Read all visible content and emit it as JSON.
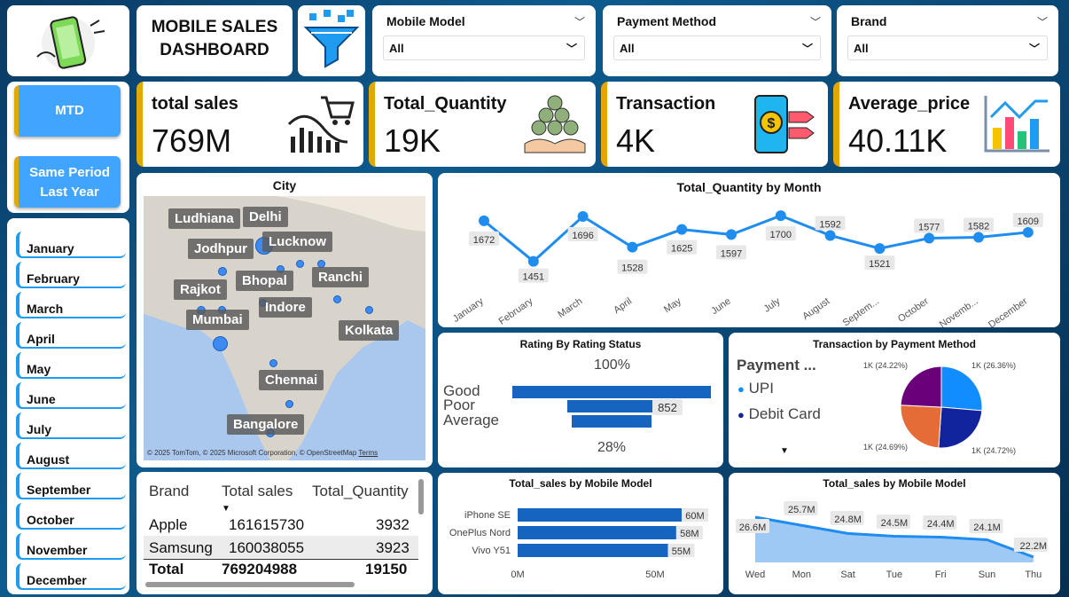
{
  "dashboard_title": "MOBILE SALES DASHBOARD",
  "icons": {
    "logo": "phone-icon",
    "filter": "funnel-icon"
  },
  "slicers": [
    {
      "label": "Mobile Model",
      "value": "All"
    },
    {
      "label": "Payment Method",
      "value": "All"
    },
    {
      "label": "Brand",
      "value": "All"
    }
  ],
  "buttons": {
    "mtd": "MTD",
    "spl": "Same Period Last Year"
  },
  "months": [
    "January",
    "February",
    "March",
    "April",
    "May",
    "June",
    "July",
    "August",
    "September",
    "October",
    "November",
    "December"
  ],
  "kpis": [
    {
      "label": "total sales",
      "value": "769M"
    },
    {
      "label": "Total_Quantity",
      "value": "19K"
    },
    {
      "label": "Transaction",
      "value": "4K"
    },
    {
      "label": "Average_price",
      "value": "40.11K"
    }
  ],
  "map": {
    "title": "City",
    "cities": [
      "Ludhiana",
      "Delhi",
      "Jodhpur",
      "Lucknow",
      "Bhopal",
      "Ranchi",
      "Rajkot",
      "Indore",
      "Mumbai",
      "Kolkata",
      "Chennai",
      "Bangalore"
    ],
    "attribution": "© 2025 TomTom, © 2025 Microsoft Corporation, © OpenStreetMap",
    "terms": "Terms"
  },
  "chart_data": [
    {
      "type": "line",
      "title": "Total_Quantity by Month",
      "categories": [
        "January",
        "February",
        "March",
        "April",
        "May",
        "June",
        "July",
        "August",
        "Septem...",
        "October",
        "Novemb...",
        "December"
      ],
      "values": [
        1672,
        1451,
        1696,
        1528,
        1625,
        1597,
        1700,
        1592,
        1521,
        1577,
        1582,
        1609
      ]
    },
    {
      "type": "bar",
      "title": "Rating By Rating Status",
      "categories": [
        "Good",
        "Poor",
        "Average"
      ],
      "pct_top": "100%",
      "pct_bottom": "28%",
      "data_label": "852",
      "values": [
        3000,
        852,
        852
      ]
    },
    {
      "type": "pie",
      "title": "Transaction by Payment Method",
      "legend_title": "Payment ...",
      "legend": [
        "UPI",
        "Debit Card"
      ],
      "slices": [
        {
          "label": "1K (26.36%)",
          "value": 26.36,
          "color": "#118dff"
        },
        {
          "label": "1K (24.72%)",
          "value": 24.72,
          "color": "#12239e"
        },
        {
          "label": "1K (24.69%)",
          "value": 24.69,
          "color": "#e66c37"
        },
        {
          "label": "1K (24.22%)",
          "value": 24.22,
          "color": "#6b007b"
        }
      ]
    },
    {
      "type": "bar",
      "title": "Total_sales by Mobile Model",
      "categories": [
        "iPhone SE",
        "OnePlus Nord",
        "Vivo Y51"
      ],
      "values": [
        60,
        58,
        55
      ],
      "labels": [
        "60M",
        "58M",
        "55M"
      ],
      "xticks": [
        "0M",
        "50M"
      ]
    },
    {
      "type": "area",
      "title": "Total_sales by Mobile Model",
      "categories": [
        "Wed",
        "Mon",
        "Sat",
        "Tue",
        "Fri",
        "Sun",
        "Thu"
      ],
      "values": [
        26.6,
        25.7,
        24.8,
        24.5,
        24.4,
        24.1,
        22.2
      ],
      "labels": [
        "26.6M",
        "25.7M",
        "24.8M",
        "24.5M",
        "24.4M",
        "24.1M",
        "22.2M"
      ]
    },
    {
      "type": "table",
      "columns": [
        "Brand",
        "Total sales",
        "Total_Quantity"
      ],
      "rows": [
        [
          "Apple",
          "161615730",
          "3932"
        ],
        [
          "Samsung",
          "160038055",
          "3923"
        ]
      ],
      "total": [
        "Total",
        "769204988",
        "19150"
      ]
    }
  ]
}
